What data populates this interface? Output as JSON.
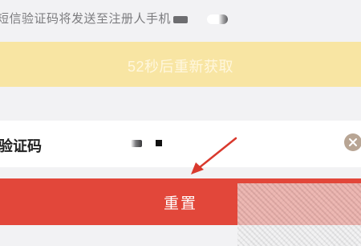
{
  "verification_notice": {
    "text": "短信验证码将发送至注册人手机"
  },
  "countdown_button": {
    "label": "52秒后重新获取"
  },
  "code_field": {
    "label": "验证码"
  },
  "reset_button": {
    "label": "重置"
  },
  "colors": {
    "countdown_bg": "#f8e5a3",
    "reset_bg": "#e2473a",
    "annotation_arrow": "#d9392d",
    "clear_icon_bg": "#b8a594"
  },
  "icons": {
    "clear": "close-circle-icon",
    "annotation": "arrow-icon"
  }
}
